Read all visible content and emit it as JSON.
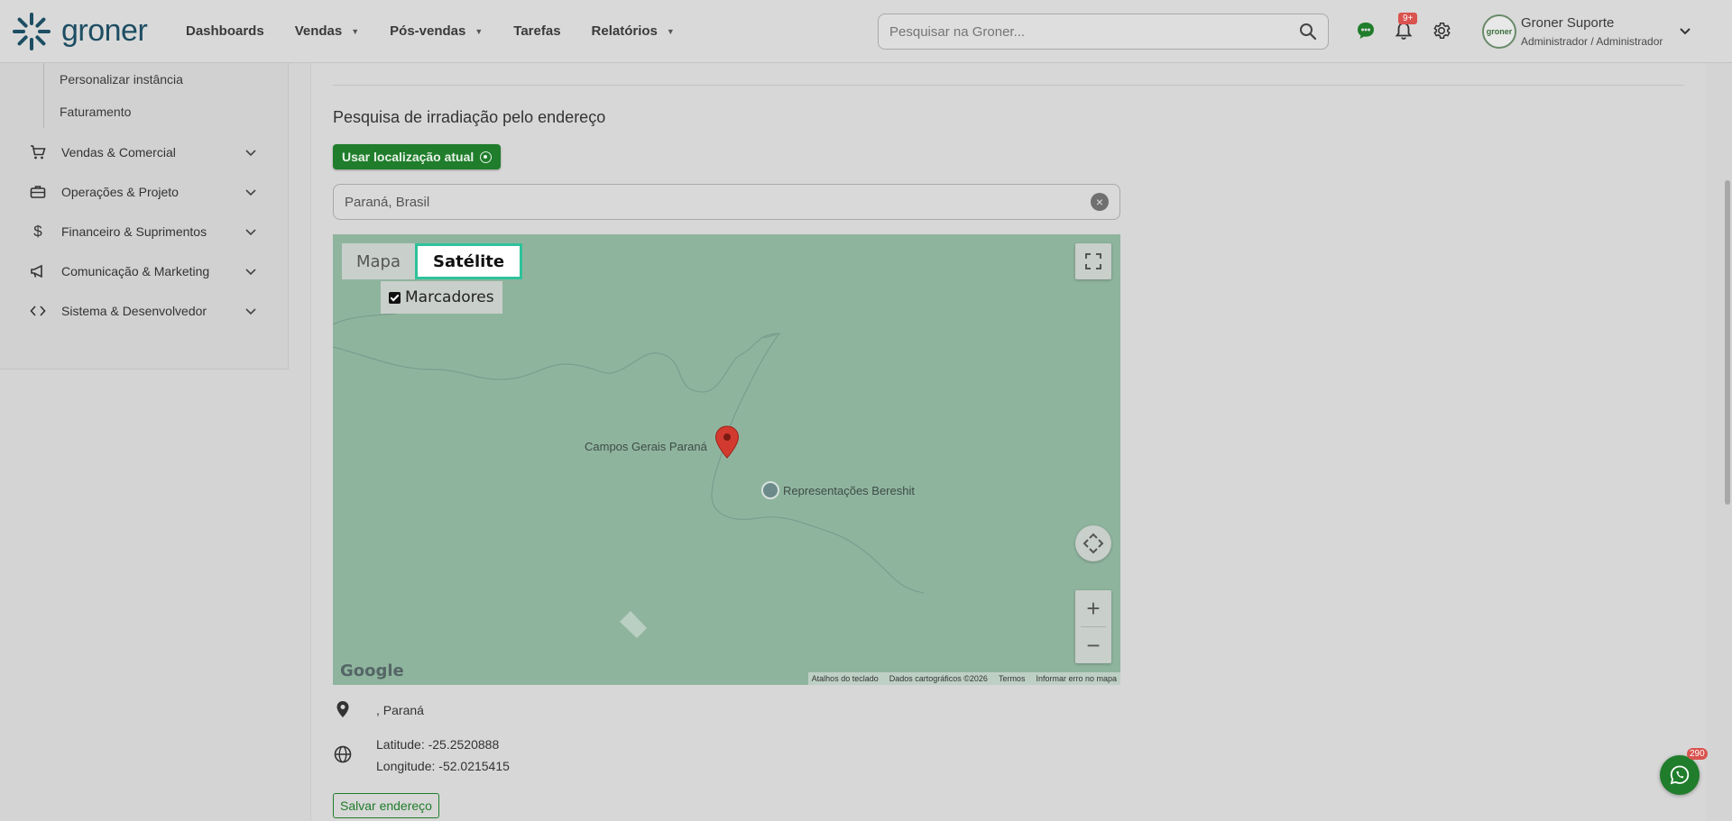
{
  "brand": {
    "name": "groner",
    "color": "#1d4e63",
    "accent": "#1f7d2b"
  },
  "nav": {
    "items": [
      {
        "label": "Dashboards",
        "dropdown": false
      },
      {
        "label": "Vendas",
        "dropdown": true
      },
      {
        "label": "Pós-vendas",
        "dropdown": true
      },
      {
        "label": "Tarefas",
        "dropdown": false
      },
      {
        "label": "Relatórios",
        "dropdown": true
      }
    ]
  },
  "search": {
    "placeholder": "Pesquisar na Groner..."
  },
  "header": {
    "notifications_badge": "9+"
  },
  "user": {
    "name": "Groner Suporte",
    "role": "Administrador / Administrador",
    "avatar_text": "groner"
  },
  "sidebar": {
    "sub_items": [
      "Personalizar instância",
      "Faturamento"
    ],
    "menu": [
      {
        "label": "Vendas & Comercial",
        "icon": "cart-icon"
      },
      {
        "label": "Operações & Projeto",
        "icon": "briefcase-icon"
      },
      {
        "label": "Financeiro & Suprimentos",
        "icon": "dollar-icon"
      },
      {
        "label": "Comunicação & Marketing",
        "icon": "megaphone-icon"
      },
      {
        "label": "Sistema & Desenvolvedor",
        "icon": "code-icon"
      }
    ]
  },
  "main": {
    "section_title": "Pesquisa de irradiação pelo endereço",
    "use_location_label": "Usar localização atual",
    "address_value": "Paraná, Brasil",
    "map": {
      "type_map": "Mapa",
      "type_satellite": "Satélite",
      "markers_label": "Marcadores",
      "place_label": "Campos Gerais Paraná",
      "poi_label": "Representações Bereshit",
      "google_logo": "Google",
      "attribution": {
        "shortcuts": "Atalhos do teclado",
        "data": "Dados cartográficos ©2026",
        "terms": "Termos",
        "report": "Informar erro no mapa"
      }
    },
    "address_line": ", Paraná",
    "latitude": "Latitude: -25.2520888",
    "longitude": "Longitude: -52.0215415",
    "save_label": "Salvar endereço"
  },
  "chat": {
    "badge": "290"
  }
}
